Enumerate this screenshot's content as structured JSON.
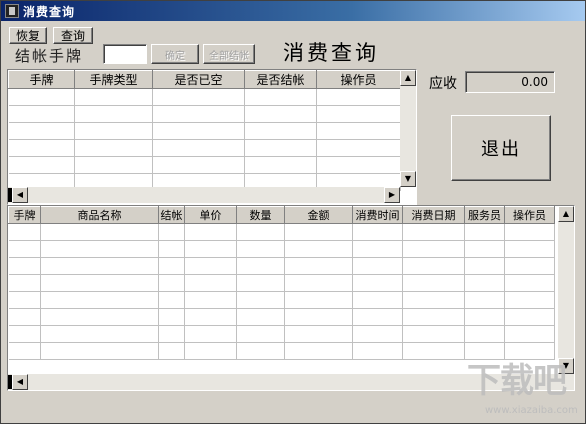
{
  "window": {
    "title": "消费查询"
  },
  "toolbar": {
    "restore_label": "恢复",
    "query_label": "查询"
  },
  "checkout": {
    "label": "结帐手牌",
    "value": "",
    "confirm_label": "确定",
    "checkout_all_label": "全部结帐"
  },
  "heading": "消费查询",
  "receivable": {
    "label": "应收",
    "value": "0.00"
  },
  "exit_label": "退出",
  "grid1": {
    "columns": [
      "手牌",
      "手牌类型",
      "是否已空",
      "是否结帐",
      "操作员"
    ],
    "rows": 7
  },
  "grid2": {
    "columns": [
      "手牌",
      "商品名称",
      "结帐",
      "单价",
      "数量",
      "金额",
      "消费时间",
      "消费日期",
      "服务员",
      "操作员"
    ],
    "rows": 9
  },
  "watermark": {
    "main": "下载吧",
    "sub": "www.xiazaiba.com"
  }
}
